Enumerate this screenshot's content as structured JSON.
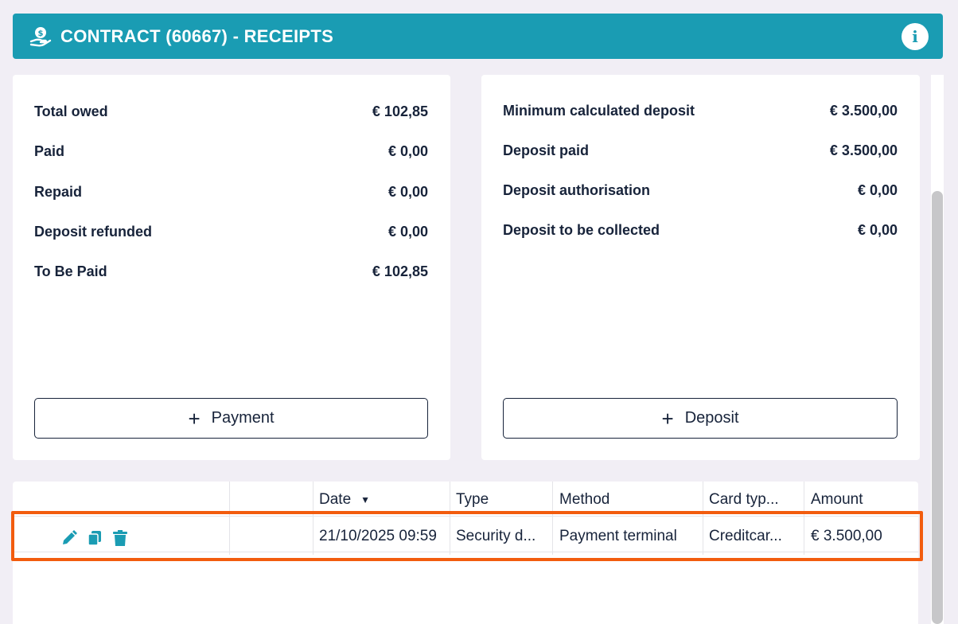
{
  "header": {
    "title": "CONTRACT (60667) - RECEIPTS",
    "info_glyph": "i",
    "icon": "hand-money-icon"
  },
  "left_summary": {
    "rows": [
      {
        "label": "Total owed",
        "value": "€ 102,85"
      },
      {
        "label": "Paid",
        "value": "€ 0,00"
      },
      {
        "label": "Repaid",
        "value": "€ 0,00"
      },
      {
        "label": "Deposit refunded",
        "value": "€ 0,00"
      },
      {
        "label": "To Be Paid",
        "value": "€ 102,85"
      }
    ],
    "button_label": "Payment"
  },
  "right_summary": {
    "rows": [
      {
        "label": "Minimum calculated deposit",
        "value": "€ 3.500,00"
      },
      {
        "label": "Deposit paid",
        "value": "€ 3.500,00"
      },
      {
        "label": "Deposit authorisation",
        "value": "€ 0,00"
      },
      {
        "label": "Deposit to be collected",
        "value": "€ 0,00"
      }
    ],
    "button_label": "Deposit"
  },
  "table": {
    "columns": [
      "Date",
      "Type",
      "Method",
      "Card typ...",
      "Amount"
    ],
    "sort_column": "Date",
    "rows": [
      {
        "date": "21/10/2025 09:59",
        "type": "Security d...",
        "method": "Payment terminal",
        "card_type": "Creditcar...",
        "amount": "€ 3.500,00",
        "actions": [
          "edit-icon",
          "copy-icon",
          "trash-icon"
        ]
      }
    ]
  },
  "colors": {
    "header_bg": "#1a9cb3",
    "action_icons": "#1a9cb3",
    "highlight": "#f25c0e",
    "text": "#17233a"
  }
}
